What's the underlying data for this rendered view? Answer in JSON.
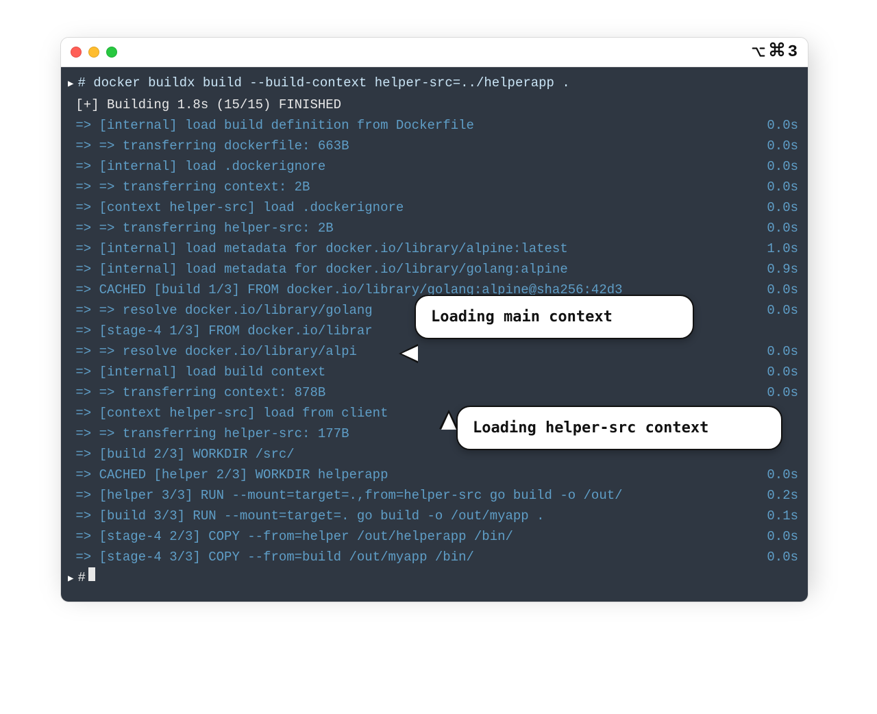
{
  "titlebar": {
    "right_label": "3"
  },
  "prompt": {
    "hash": "#",
    "command": "docker buildx build --build-context helper-src=../helperapp ."
  },
  "status_line": "[+] Building 1.8s (15/15) FINISHED",
  "lines": [
    {
      "text": "=> [internal] load build definition from Dockerfile",
      "time": "0.0s"
    },
    {
      "text": "=> => transferring dockerfile: 663B",
      "time": "0.0s"
    },
    {
      "text": "=> [internal] load .dockerignore",
      "time": "0.0s"
    },
    {
      "text": "=> => transferring context: 2B",
      "time": "0.0s"
    },
    {
      "text": "=> [context helper-src] load .dockerignore",
      "time": "0.0s"
    },
    {
      "text": "=> => transferring helper-src: 2B",
      "time": "0.0s"
    },
    {
      "text": "=> [internal] load metadata for docker.io/library/alpine:latest",
      "time": "1.0s"
    },
    {
      "text": "=> [internal] load metadata for docker.io/library/golang:alpine",
      "time": "0.9s"
    },
    {
      "text": "=> CACHED [build 1/3] FROM docker.io/library/golang:alpine@sha256:42d3",
      "time": "0.0s"
    },
    {
      "text": "=> => resolve docker.io/library/golang",
      "time": "0.0s"
    },
    {
      "text": "=> [stage-4 1/3] FROM docker.io/librar",
      "time": ""
    },
    {
      "text": "=> => resolve docker.io/library/alpi",
      "time": "0.0s"
    },
    {
      "text": "=> [internal] load build context",
      "time": "0.0s"
    },
    {
      "text": "=> => transferring context: 878B",
      "time": "0.0s"
    },
    {
      "text": "=> [context helper-src] load from client",
      "time": ""
    },
    {
      "text": "=> => transferring helper-src: 177B",
      "time": ""
    },
    {
      "text": "=> [build 2/3] WORKDIR /src/",
      "time": ""
    },
    {
      "text": "=> CACHED [helper 2/3] WORKDIR helperapp",
      "time": "0.0s"
    },
    {
      "text": "=> [helper 3/3] RUN --mount=target=.,from=helper-src go build -o /out/",
      "time": "0.2s"
    },
    {
      "text": "=> [build 3/3] RUN --mount=target=. go build -o /out/myapp .",
      "time": "0.1s"
    },
    {
      "text": "=> [stage-4 2/3] COPY --from=helper /out/helperapp /bin/",
      "time": "0.0s"
    },
    {
      "text": "=> [stage-4 3/3] COPY --from=build /out/myapp /bin/",
      "time": "0.0s"
    }
  ],
  "final_prompt": "#",
  "callouts": {
    "c1": "Loading main context",
    "c2": "Loading helper-src context"
  }
}
